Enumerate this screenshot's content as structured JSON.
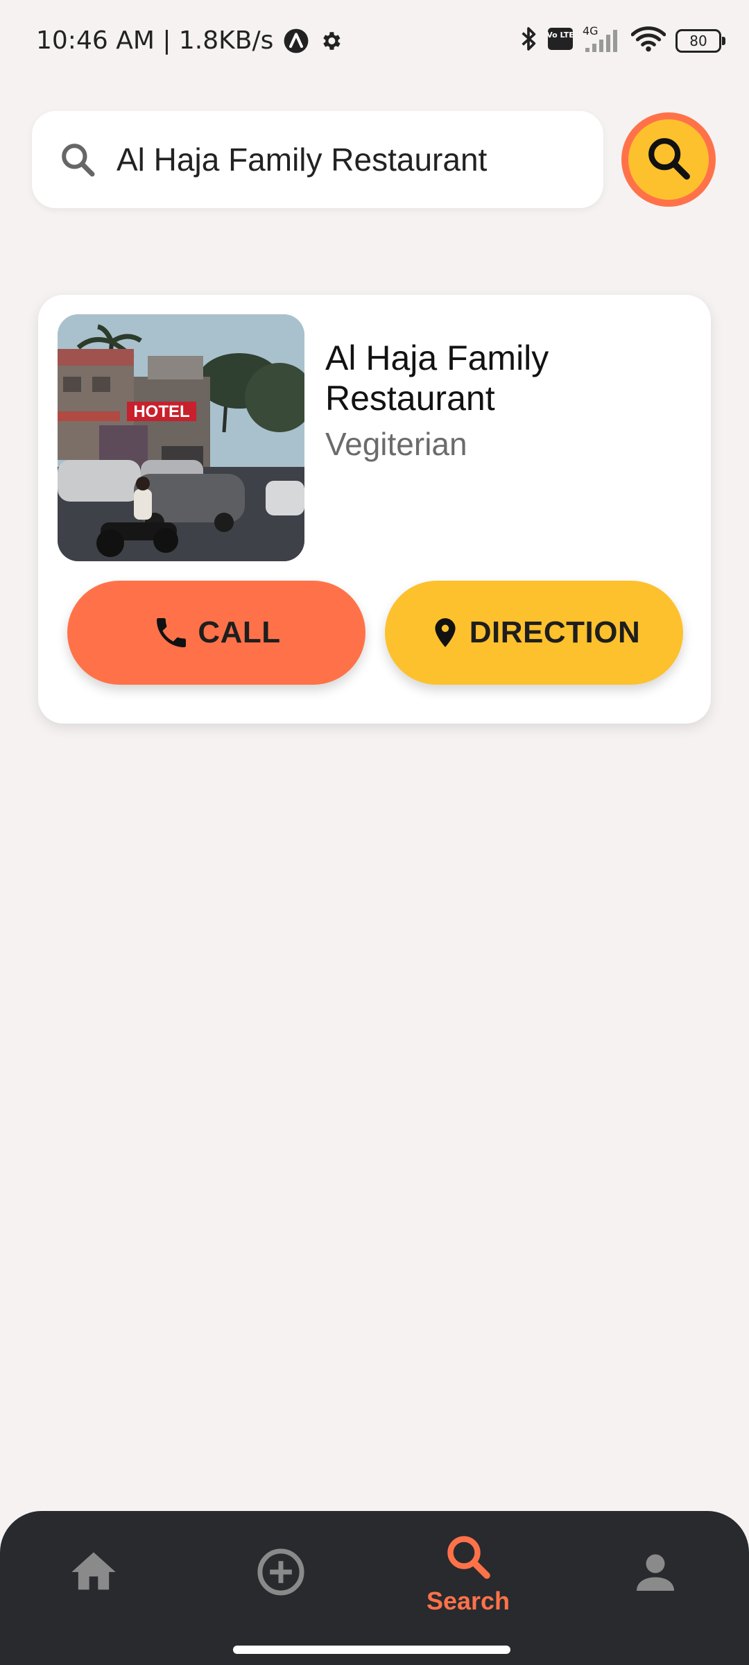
{
  "status_bar": {
    "time_speed": "10:46 AM | 1.8KB/s",
    "battery": "80",
    "network_badge": "4G",
    "volte_badge": "Vo LTE",
    "icons": [
      "app-notification-icon",
      "settings-gear-icon",
      "bluetooth-icon",
      "volte-icon",
      "signal-icon",
      "wifi-icon",
      "battery-icon"
    ]
  },
  "search": {
    "value": "Al Haja Family Restaurant",
    "icon": "search-icon",
    "button_icon": "search-icon"
  },
  "result": {
    "name": "Al Haja Family Restaurant",
    "category": "Vegiterian",
    "photo_text": "HOTEL",
    "call_label": "CALL",
    "direction_label": "DIRECTION"
  },
  "nav": {
    "items": [
      {
        "icon": "home-icon",
        "label": ""
      },
      {
        "icon": "add-circle-icon",
        "label": ""
      },
      {
        "icon": "search-icon",
        "label": "Search",
        "active": true
      },
      {
        "icon": "person-icon",
        "label": ""
      }
    ]
  },
  "colors": {
    "accent_orange": "#ff7249",
    "accent_yellow": "#fdc12d",
    "nav_bg": "#282a2e",
    "background": "#f5f2f1",
    "inactive_icon": "#8a8a8a"
  }
}
